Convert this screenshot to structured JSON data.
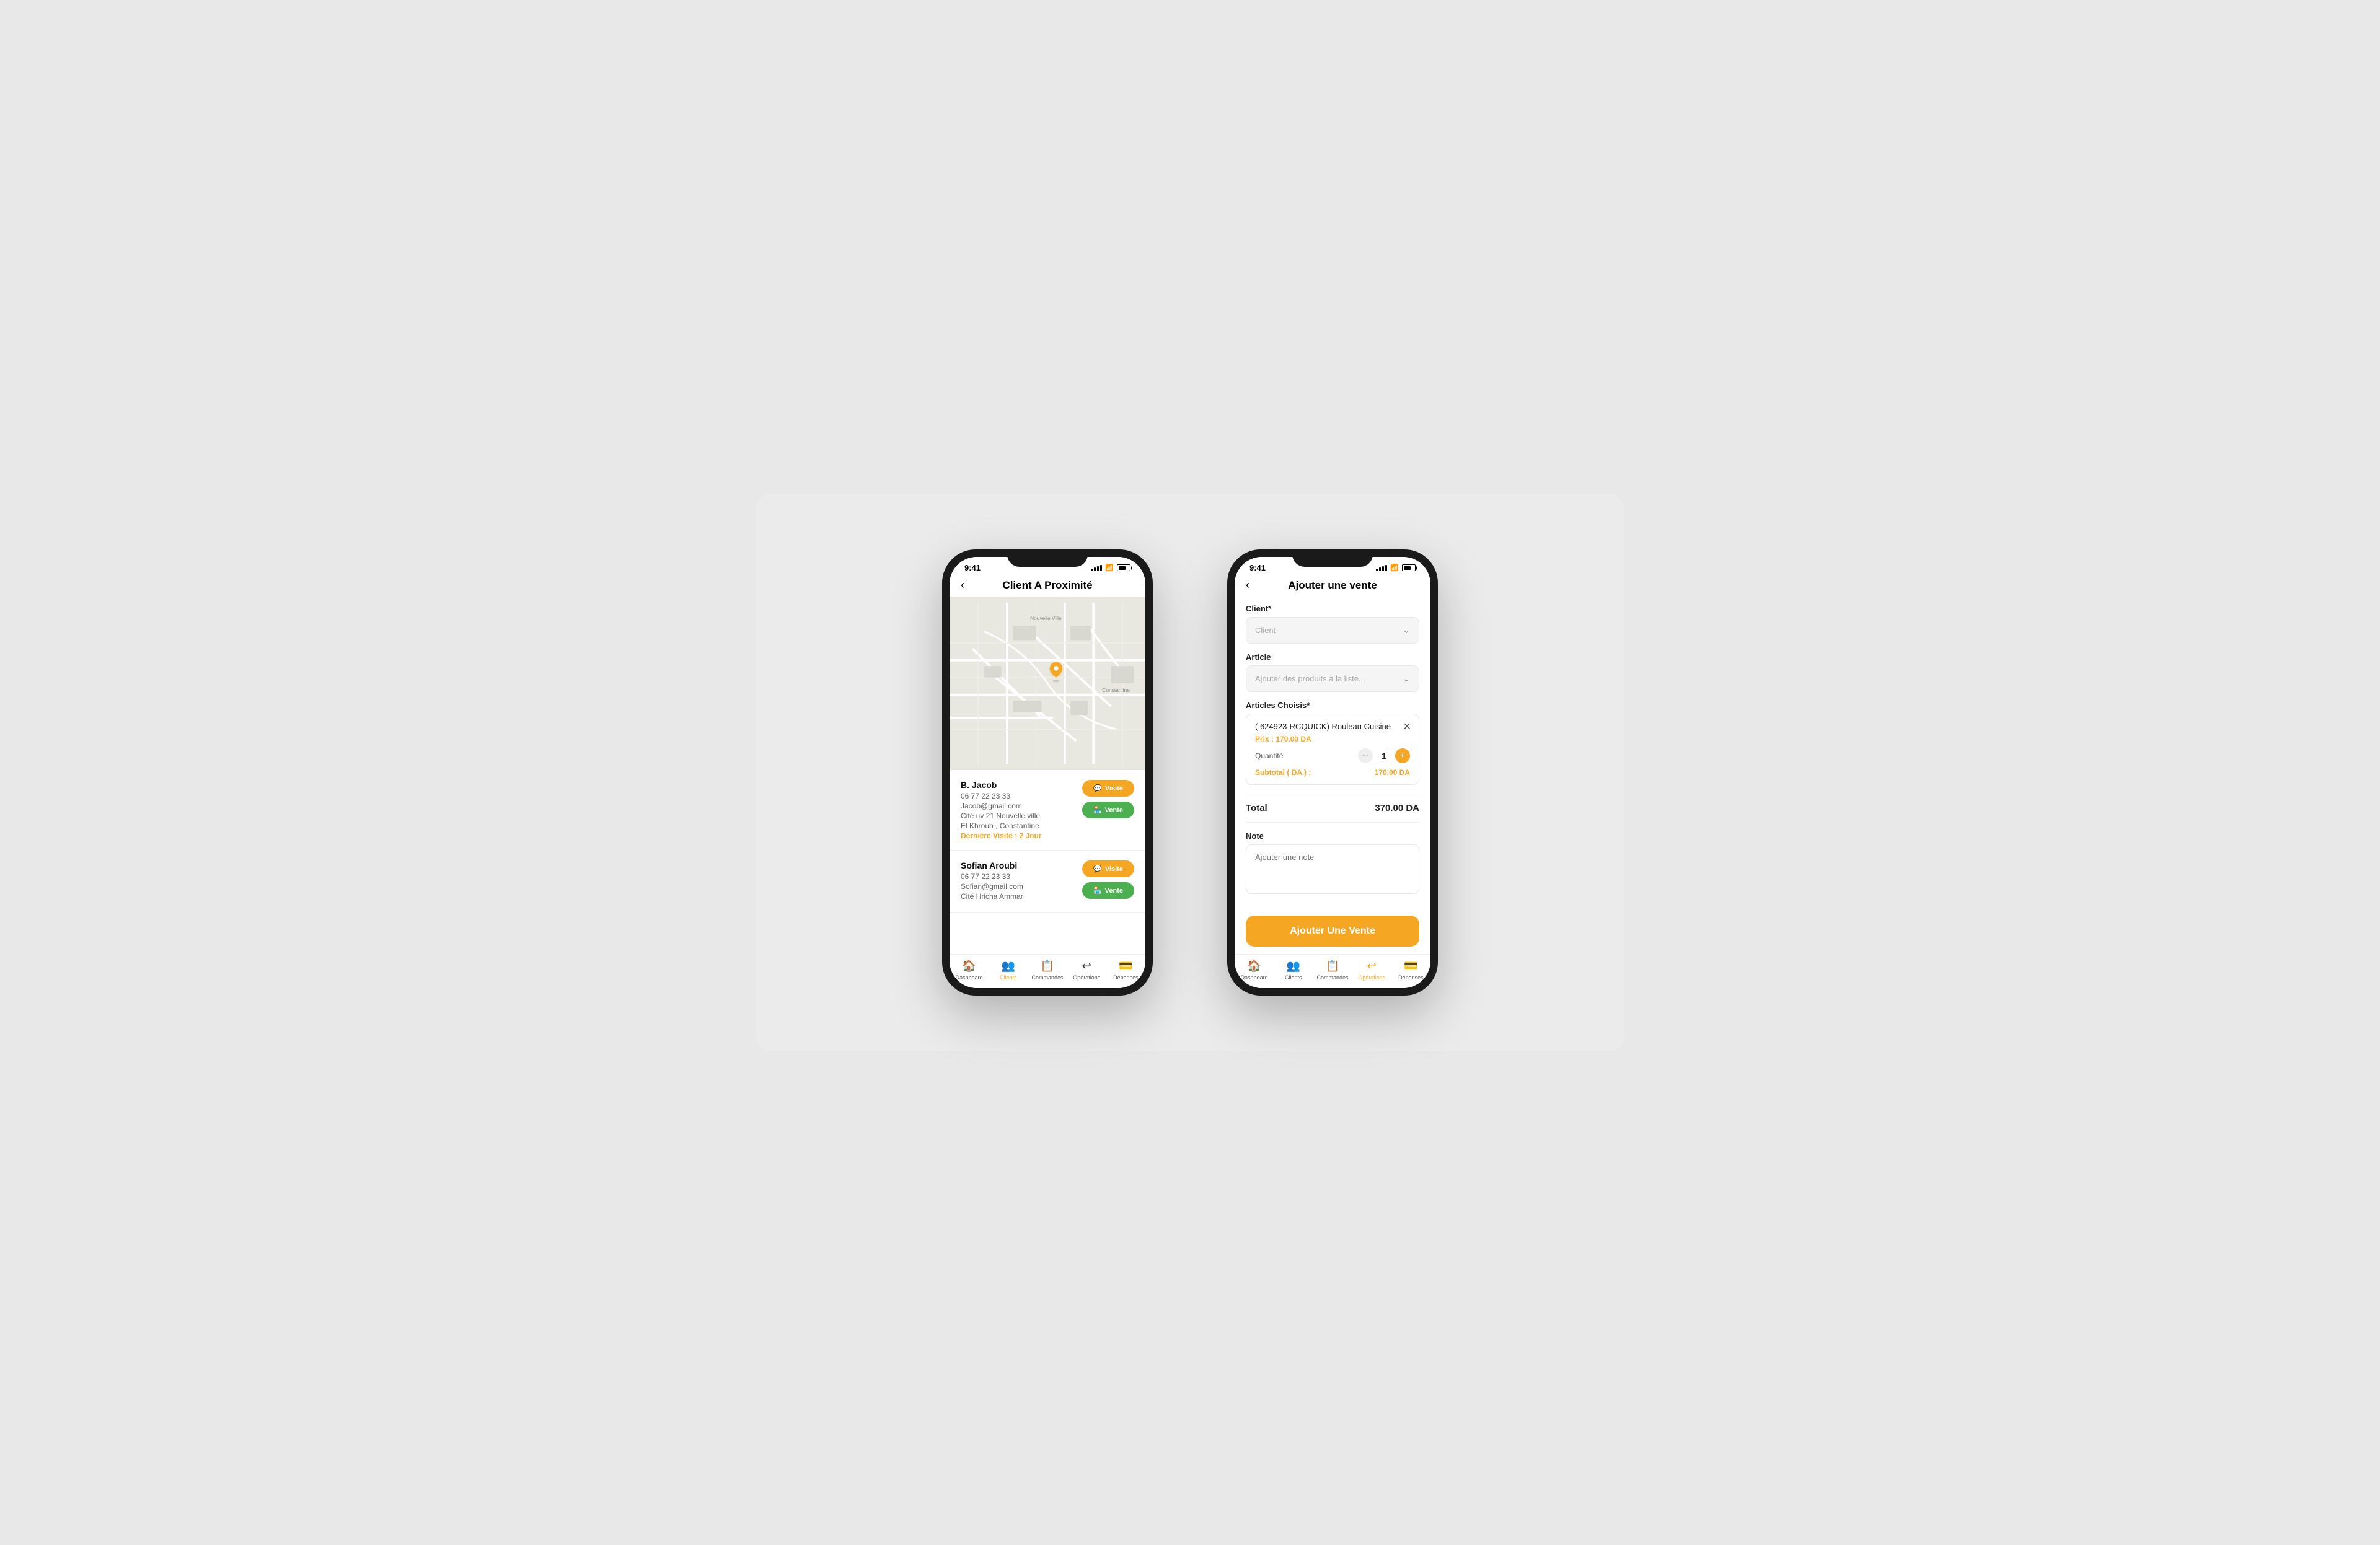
{
  "phone1": {
    "status_time": "9:41",
    "title": "Client A Proximité",
    "map_label": "Nouvelle Ville",
    "map_label2": "Constantine",
    "clients": [
      {
        "name": "B. Jacob",
        "phone": "06 77 22 23 33",
        "email": "Jacob@gmail.com",
        "address": "Cité uv 21 Nouvelle ville",
        "city": "El Khroub , Constantine",
        "last_visit": "Dernière Visite : 2 Jour",
        "btn_visite": "Visite",
        "btn_vente": "Vente"
      },
      {
        "name": "Sofian Aroubi",
        "phone": "06 77 22 23 33",
        "email": "Sofian@gmail.com",
        "address": "Cité Hricha Ammar",
        "city": "",
        "last_visit": "",
        "btn_visite": "Visite",
        "btn_vente": "Vente"
      }
    ],
    "nav": [
      {
        "label": "Dashboard",
        "icon": "🏠",
        "active": false
      },
      {
        "label": "Clients",
        "icon": "👥",
        "active": true
      },
      {
        "label": "Commandes",
        "icon": "📋",
        "active": false
      },
      {
        "label": "Opérations",
        "icon": "↩",
        "active": false
      },
      {
        "label": "Dépenses",
        "icon": "💳",
        "active": false
      }
    ]
  },
  "phone2": {
    "status_time": "9:41",
    "title": "Ajouter une vente",
    "client_label": "Client*",
    "client_placeholder": "Client",
    "article_label": "Article",
    "article_placeholder": "Ajouter des produits à la liste...",
    "articles_choisis_label": "Articles Choisis*",
    "article_item": {
      "name": "( 624923-RCQUICK) Rouleau Cuisine",
      "price_label": "Prix : 170.00 DA",
      "qty_label": "Quantité",
      "qty": "1",
      "subtotal_label": "Subtotal ( DA ) :",
      "subtotal_val": "170.00 DA"
    },
    "total_label": "Total",
    "total_val": "370.00 DA",
    "note_label": "Note",
    "note_placeholder": "Ajouter une note",
    "add_btn": "Ajouter Une Vente",
    "nav": [
      {
        "label": "Dashboard",
        "icon": "🏠",
        "active": false
      },
      {
        "label": "Clients",
        "icon": "👥",
        "active": false
      },
      {
        "label": "Commandes",
        "icon": "📋",
        "active": false
      },
      {
        "label": "Opérations",
        "icon": "↩",
        "active": true
      },
      {
        "label": "Dépenses",
        "icon": "💳",
        "active": false
      }
    ]
  },
  "colors": {
    "orange": "#f5a623",
    "green": "#4caf50",
    "active_nav": "#f5a623"
  }
}
